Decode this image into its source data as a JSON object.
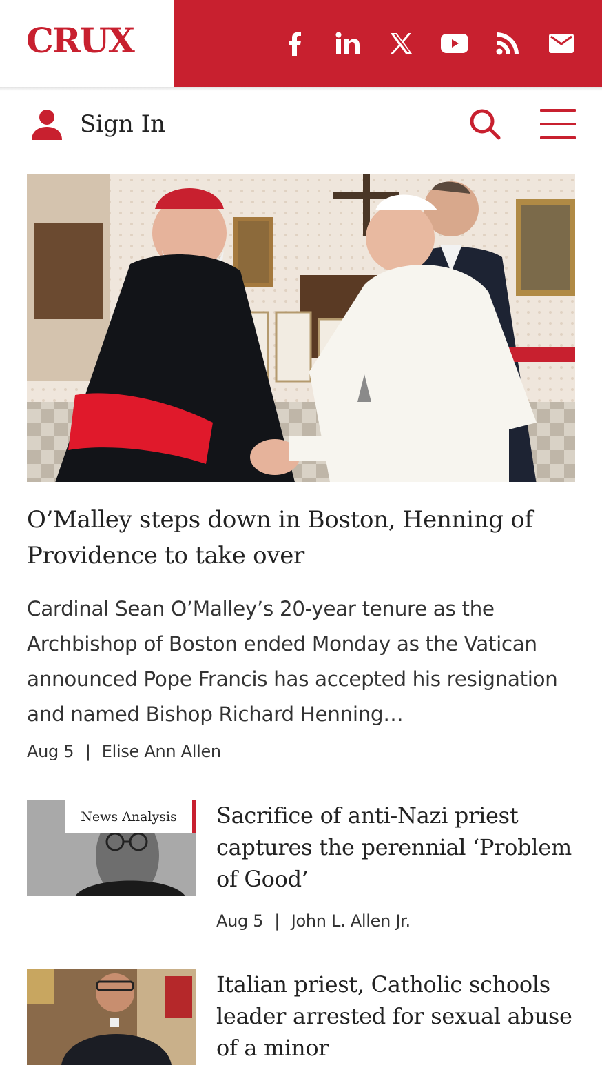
{
  "header": {
    "logo": "CRUX",
    "social_icons": [
      "facebook-icon",
      "linkedin-icon",
      "x-icon",
      "youtube-icon",
      "rss-icon",
      "mail-icon"
    ],
    "brand_color": "#c8202f"
  },
  "account": {
    "sign_in_label": "Sign In"
  },
  "hero": {
    "title": "O’Malley steps down in Boston, Henning of Providence to take over",
    "summary": "Cardinal Sean O’Malley’s 20-year tenure as the Archbishop of Boston ended Monday as the Vatican announced Pope Francis has accepted his resignation and named Bishop Richard Henning…",
    "date": "Aug 5",
    "separator": "|",
    "author": "Elise Ann Allen"
  },
  "stories": [
    {
      "tag": "News Analysis",
      "title": "Sacrifice of anti-Nazi priest captures the perennial ‘Problem of Good’",
      "date": "Aug 5",
      "separator": "|",
      "author": "John L. Allen Jr."
    },
    {
      "title": "Italian priest, Catholic schools leader arrested for sexual abuse of a minor"
    }
  ]
}
